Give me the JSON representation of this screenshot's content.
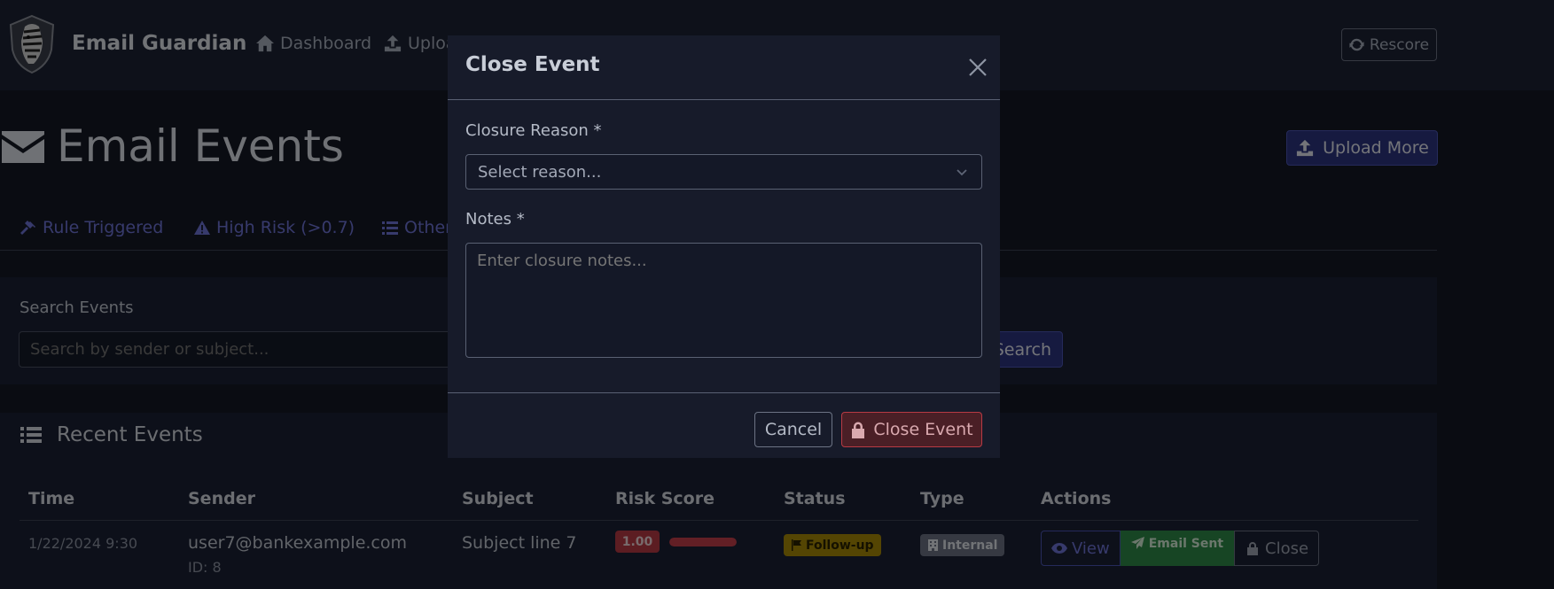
{
  "navbar": {
    "brand": "Email Guardian",
    "links": [
      {
        "label": "Dashboard",
        "icon": "home-icon"
      },
      {
        "label": "Uploa",
        "icon": "upload-icon"
      }
    ],
    "rescore_label": "Rescore"
  },
  "page": {
    "title": "Email Events",
    "upload_more_label": "Upload More"
  },
  "tabs": [
    {
      "label": "Rule Triggered",
      "icon": "gavel-icon"
    },
    {
      "label": "High Risk (>0.7)",
      "icon": "warning-icon"
    },
    {
      "label": "Other",
      "icon": "list-icon"
    }
  ],
  "search": {
    "label": "Search Events",
    "placeholder": "Search by sender or subject...",
    "button_label": "Search"
  },
  "events": {
    "header": "Recent Events",
    "columns": [
      "Time",
      "Sender",
      "Subject",
      "Risk Score",
      "Status",
      "Type",
      "Actions"
    ],
    "rows": [
      {
        "time": "1/22/2024 9:30",
        "sender": "user7@bankexample.com",
        "id": "ID: 8",
        "subject": "Subject line 7",
        "risk_score": "1.00",
        "risk_fraction": 1.0,
        "status": "Follow-up",
        "type": "Internal",
        "actions": {
          "view": "View",
          "email_sent": "Email Sent",
          "close": "Close"
        }
      }
    ]
  },
  "modal": {
    "title": "Close Event",
    "reason_label": "Closure Reason *",
    "reason_selected": "Select reason...",
    "notes_label": "Notes *",
    "notes_placeholder": "Enter closure notes...",
    "cancel_label": "Cancel",
    "confirm_label": "Close Event"
  },
  "colors": {
    "navbar_bg": "#1c2235",
    "page_bg": "#151925",
    "card_bg": "#1b2134",
    "primary": "#2c3580",
    "link": "#6f74d8",
    "danger": "#b83a44",
    "warning": "#a88a06",
    "success": "#2f8a48",
    "secondary": "#6c7384"
  }
}
